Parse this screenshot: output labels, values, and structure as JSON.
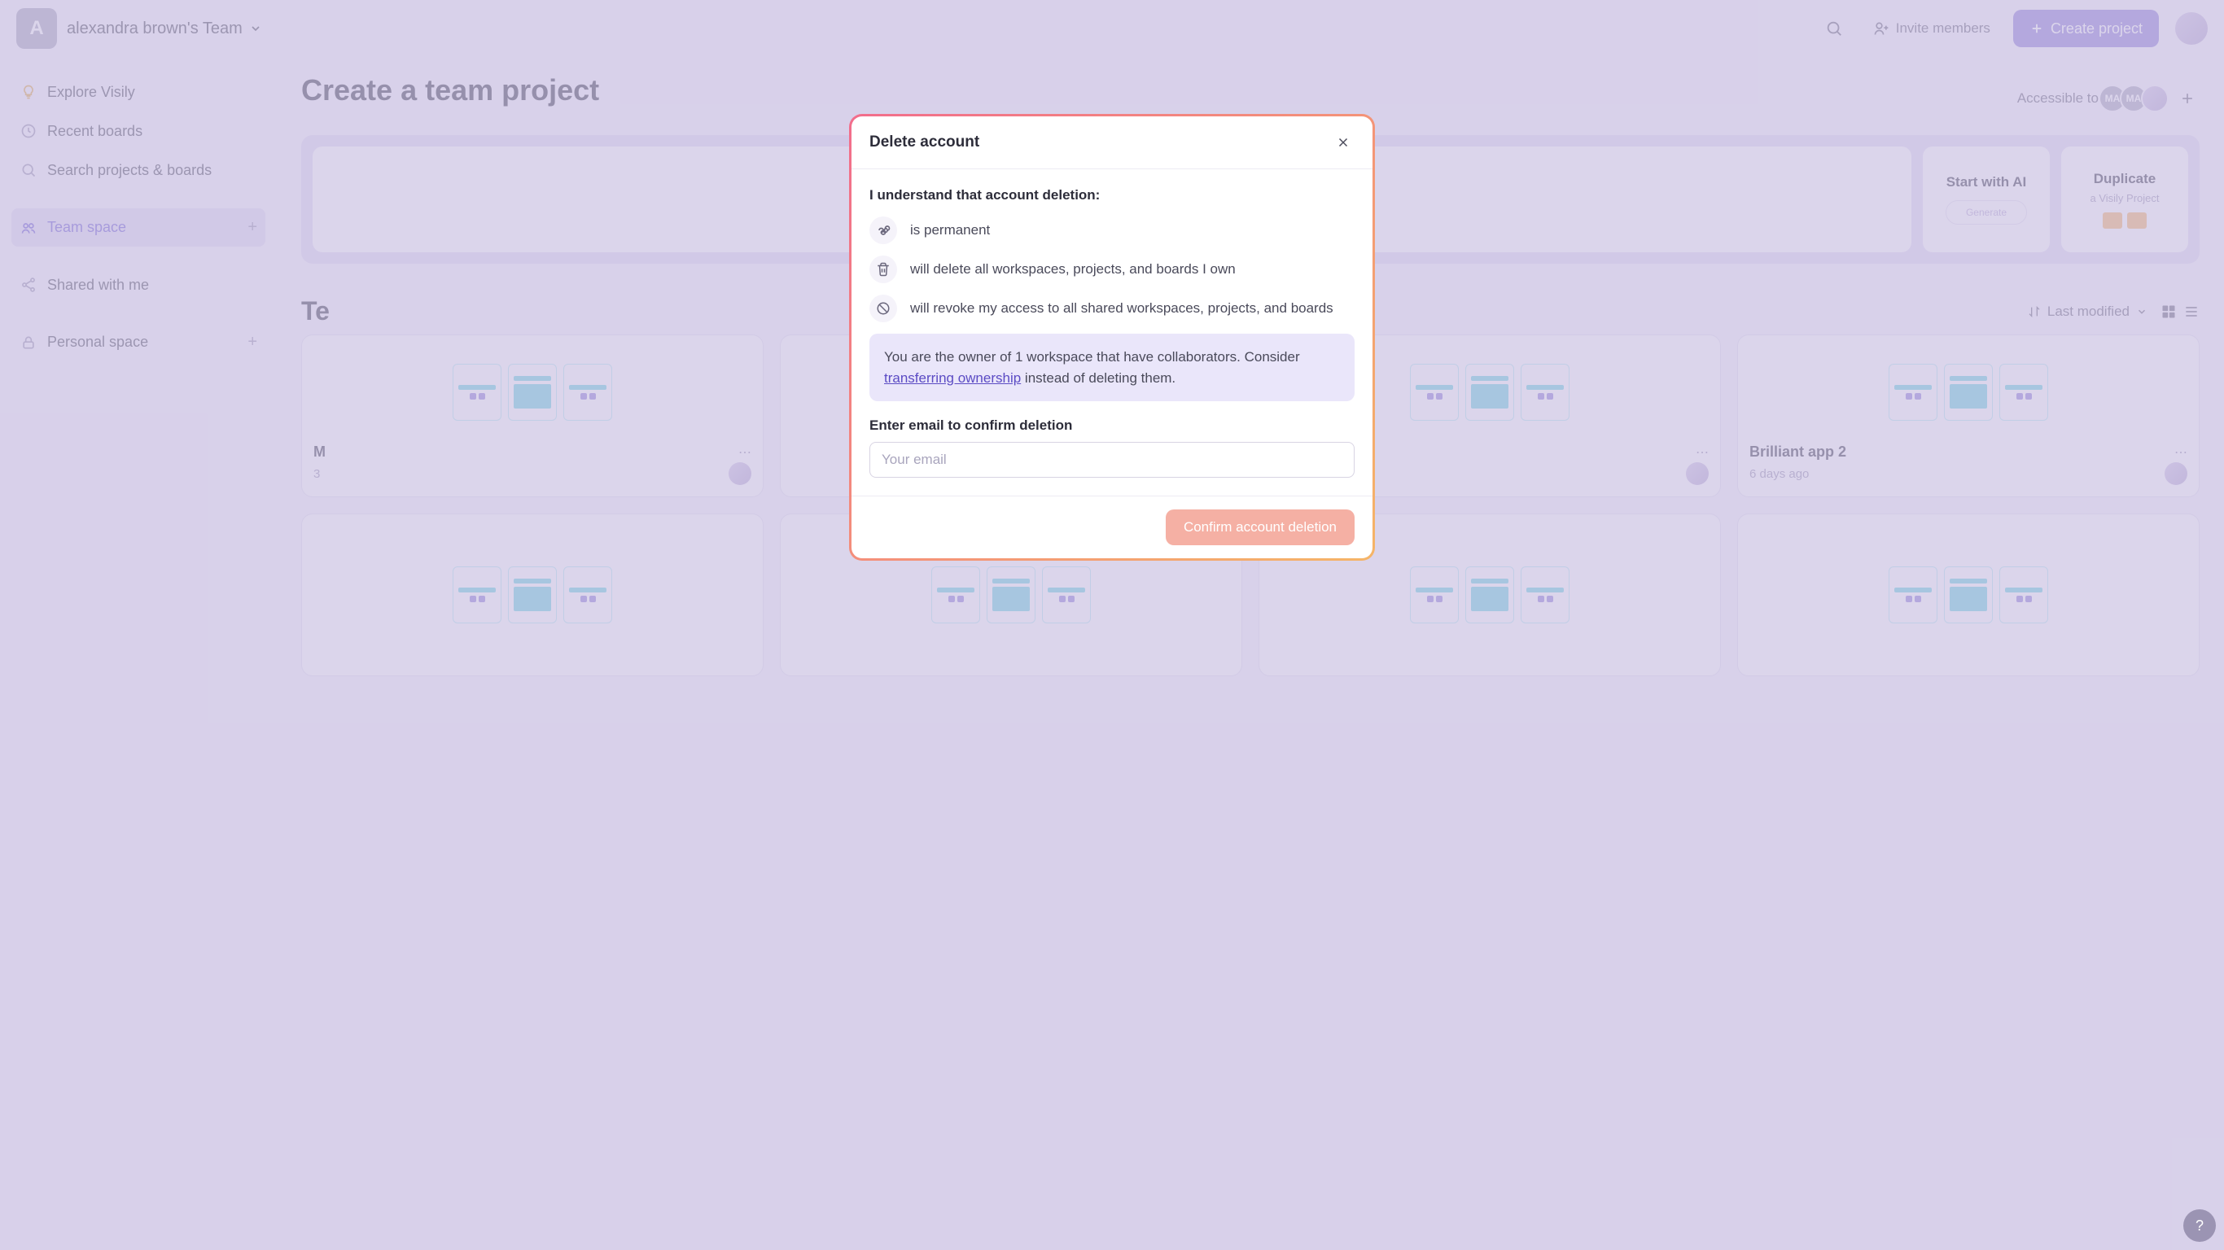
{
  "topbar": {
    "team_initial": "A",
    "team_name": "alexandra brown's Team",
    "invite_label": "Invite members",
    "create_project_label": "Create project"
  },
  "sidebar": {
    "explore": "Explore Visily",
    "recent": "Recent boards",
    "search": "Search projects & boards",
    "team_space": "Team space",
    "shared": "Shared with me",
    "personal": "Personal space"
  },
  "main": {
    "heading": "Create a team project",
    "accessible_label": "Accessible to",
    "avatar_badges": [
      "MA",
      "MA"
    ],
    "cards": {
      "start_ai_title": "Start with AI",
      "start_ai_placeholder": "Generate",
      "duplicate_title": "Duplicate",
      "duplicate_sub": "a Visily Project"
    },
    "section_title": "Te",
    "sort_label": "Last modified",
    "projects": [
      {
        "title": "M",
        "date": "3",
        "show_footer": true
      },
      {
        "title": "",
        "date": "",
        "show_footer": false
      },
      {
        "title": "",
        "date": "",
        "show_footer": true
      },
      {
        "title": "Brilliant app 2",
        "date": "6 days ago",
        "show_footer": true
      }
    ]
  },
  "modal": {
    "title": "Delete account",
    "understand_label": "I understand that account deletion:",
    "bullets": [
      "is permanent",
      "will delete all workspaces, projects, and boards I own",
      "will revoke my access to all shared workspaces, projects, and boards"
    ],
    "warning_prefix": "You are the owner of 1 workspace that have collaborators. Consider ",
    "warning_link": "transferring ownership",
    "warning_suffix": " instead of deleting them.",
    "confirm_label": "Enter email to confirm deletion",
    "email_placeholder": "Your email",
    "confirm_button": "Confirm account deletion"
  }
}
